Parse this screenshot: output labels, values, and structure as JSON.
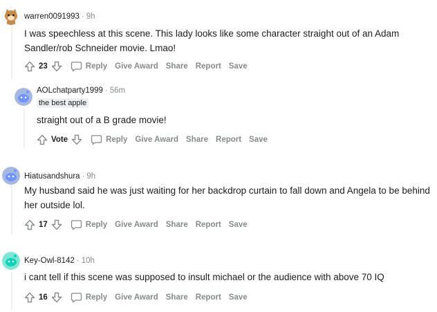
{
  "colors": {
    "text": "#1c1c1c",
    "muted": "#878a8c",
    "thread": "#edeff1",
    "avatar_blue": "#7193ff",
    "avatar_teal": "#0dd3bb"
  },
  "actions": {
    "reply": "Reply",
    "give_award": "Give Award",
    "share": "Share",
    "report": "Report",
    "save": "Save"
  },
  "comments": [
    {
      "author": "warren0091993",
      "time": "9h",
      "avatar_icon": "cat-avatar-icon",
      "text": "I was speechless at this scene. This lady looks like some character straight out of an Adam Sandler/rob Schneider movie. Lmao!",
      "score": "23"
    },
    {
      "author": "AOLchatparty1999",
      "time": "56m",
      "flair": "the best apple",
      "avatar_icon": "snoo-avatar-icon",
      "text": "straight out of a B grade movie!",
      "score": "Vote"
    },
    {
      "author": "Hiatusandshura",
      "time": "9h",
      "avatar_icon": "snoo-avatar-icon",
      "text": "My husband said he was just waiting for her backdrop curtain to fall down and Angela to be behind her outside lol.",
      "score": "17"
    },
    {
      "author": "Key-Owl-8142",
      "time": "10h",
      "avatar_icon": "snoo-avatar-icon",
      "text": "i cant tell if this scene was supposed to insult michael or the audience with above 70 IQ",
      "score": "16"
    }
  ]
}
